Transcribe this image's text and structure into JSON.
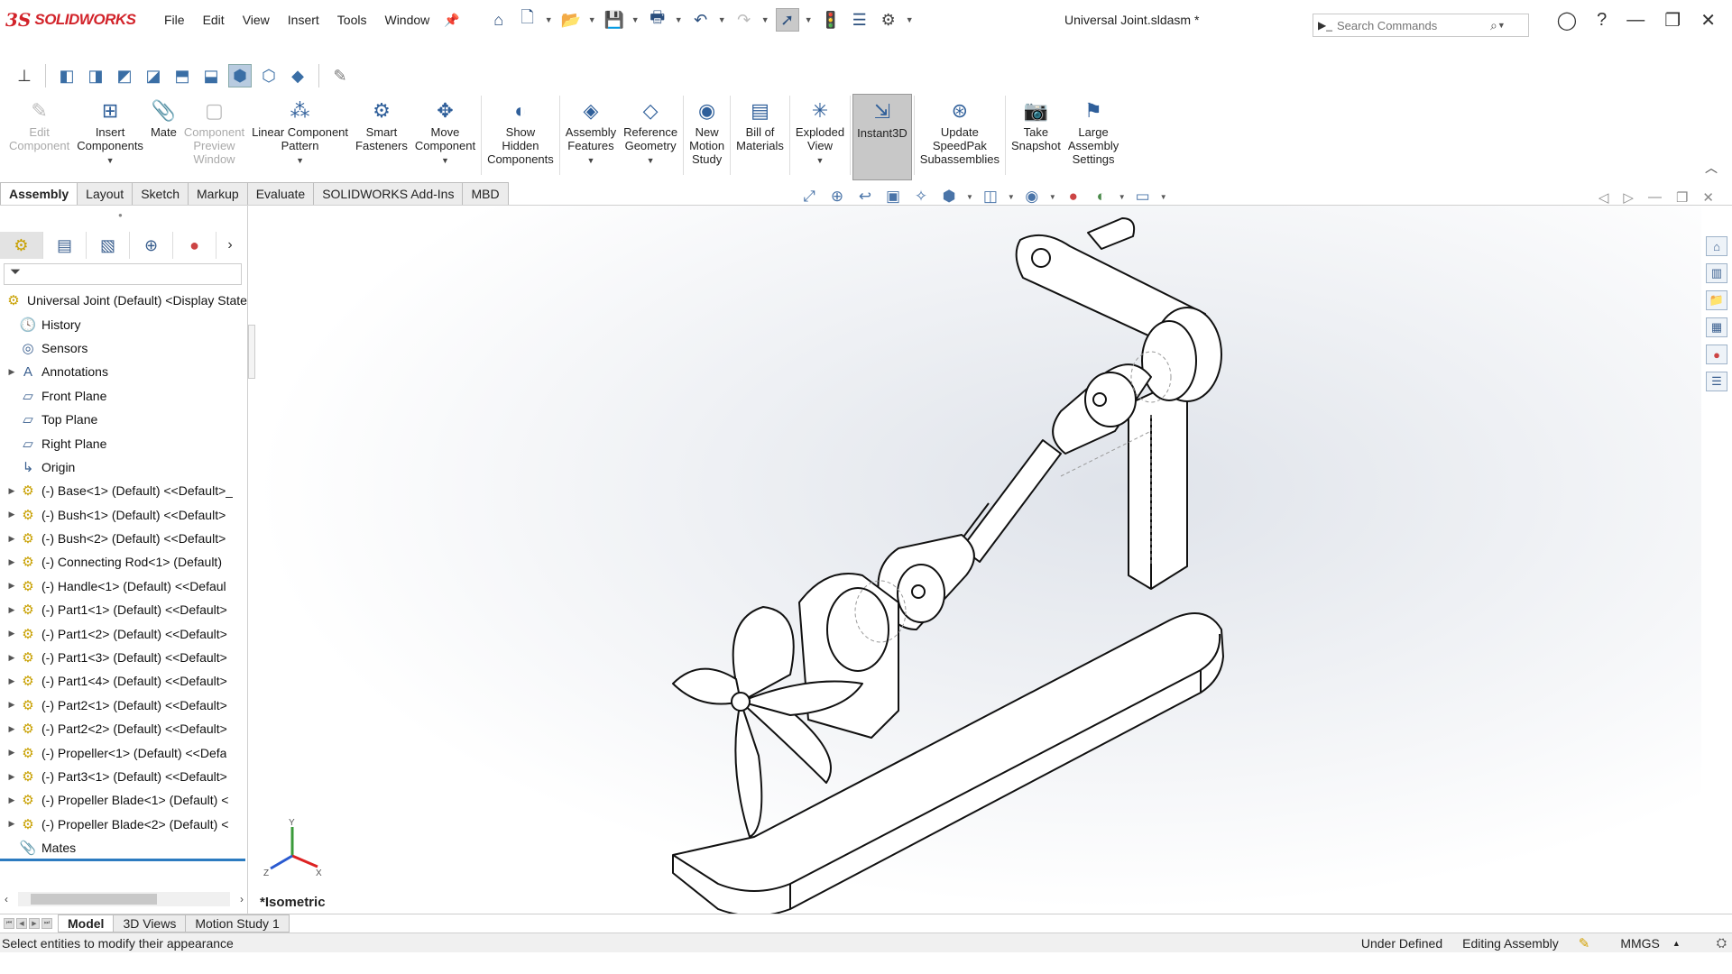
{
  "app": {
    "brand_ds": "3S",
    "brand_name": "SOLIDWORKS"
  },
  "menu": [
    "File",
    "Edit",
    "View",
    "Insert",
    "Tools",
    "Window"
  ],
  "document_title": "Universal Joint.sldasm *",
  "search": {
    "placeholder": "Search Commands"
  },
  "command_manager": [
    {
      "label": "Edit\nComponent",
      "disabled": true,
      "icon": "edit-component-icon"
    },
    {
      "label": "Insert\nComponents",
      "dropdown": true,
      "icon": "insert-components-icon"
    },
    {
      "label": "Mate",
      "icon": "mate-icon"
    },
    {
      "label": "Component\nPreview\nWindow",
      "disabled": true,
      "icon": "component-preview-icon"
    },
    {
      "label": "Linear Component\nPattern",
      "dropdown": true,
      "icon": "linear-pattern-icon"
    },
    {
      "label": "Smart\nFasteners",
      "icon": "smart-fasteners-icon"
    },
    {
      "label": "Move\nComponent",
      "dropdown": true,
      "icon": "move-component-icon"
    },
    {
      "label": "Show\nHidden\nComponents",
      "icon": "show-hidden-icon"
    },
    {
      "label": "Assembly\nFeatures",
      "dropdown": true,
      "icon": "assembly-features-icon"
    },
    {
      "label": "Reference\nGeometry",
      "dropdown": true,
      "icon": "reference-geometry-icon"
    },
    {
      "label": "New\nMotion\nStudy",
      "icon": "motion-study-icon"
    },
    {
      "label": "Bill of\nMaterials",
      "icon": "bom-icon"
    },
    {
      "label": "Exploded\nView",
      "dropdown": true,
      "icon": "exploded-view-icon"
    },
    {
      "label": "Instant3D",
      "active": true,
      "icon": "instant3d-icon"
    },
    {
      "label": "Update\nSpeedPak\nSubassemblies",
      "icon": "speedpak-icon"
    },
    {
      "label": "Take\nSnapshot",
      "icon": "snapshot-icon"
    },
    {
      "label": "Large\nAssembly\nSettings",
      "icon": "large-assembly-icon"
    }
  ],
  "tabs": [
    "Assembly",
    "Layout",
    "Sketch",
    "Markup",
    "Evaluate",
    "SOLIDWORKS Add-Ins",
    "MBD"
  ],
  "active_tab": "Assembly",
  "tree": [
    {
      "label": "Universal Joint (Default) <Display State",
      "icon": "assembly-icon",
      "expand": false,
      "indent": 0
    },
    {
      "label": "History",
      "icon": "history-icon",
      "expand": false,
      "indent": 1
    },
    {
      "label": "Sensors",
      "icon": "sensor-icon",
      "expand": false,
      "indent": 1
    },
    {
      "label": "Annotations",
      "icon": "annotation-icon",
      "expand": true,
      "indent": 1
    },
    {
      "label": "Front Plane",
      "icon": "plane-icon",
      "expand": false,
      "indent": 1
    },
    {
      "label": "Top Plane",
      "icon": "plane-icon",
      "expand": false,
      "indent": 1
    },
    {
      "label": "Right Plane",
      "icon": "plane-icon",
      "expand": false,
      "indent": 1
    },
    {
      "label": "Origin",
      "icon": "origin-icon",
      "expand": false,
      "indent": 1
    },
    {
      "label": "(-) Base<1> (Default) <<Default>_",
      "icon": "part-icon",
      "expand": true,
      "indent": 1
    },
    {
      "label": "(-) Bush<1> (Default) <<Default>",
      "icon": "part-icon",
      "expand": true,
      "indent": 1
    },
    {
      "label": "(-) Bush<2> (Default) <<Default>",
      "icon": "part-icon",
      "expand": true,
      "indent": 1
    },
    {
      "label": "(-) Connecting Rod<1> (Default)",
      "icon": "part-icon",
      "expand": true,
      "indent": 1
    },
    {
      "label": "(-) Handle<1> (Default) <<Defaul",
      "icon": "part-icon",
      "expand": true,
      "indent": 1
    },
    {
      "label": "(-) Part1<1> (Default) <<Default>",
      "icon": "part-icon",
      "expand": true,
      "indent": 1
    },
    {
      "label": "(-) Part1<2> (Default) <<Default>",
      "icon": "part-icon",
      "expand": true,
      "indent": 1
    },
    {
      "label": "(-) Part1<3> (Default) <<Default>",
      "icon": "part-icon",
      "expand": true,
      "indent": 1
    },
    {
      "label": "(-) Part1<4> (Default) <<Default>",
      "icon": "part-icon",
      "expand": true,
      "indent": 1
    },
    {
      "label": "(-) Part2<1> (Default) <<Default>",
      "icon": "part-icon",
      "expand": true,
      "indent": 1
    },
    {
      "label": "(-) Part2<2> (Default) <<Default>",
      "icon": "part-icon",
      "expand": true,
      "indent": 1
    },
    {
      "label": "(-) Propeller<1> (Default) <<Defa",
      "icon": "part-icon",
      "expand": true,
      "indent": 1
    },
    {
      "label": "(-) Part3<1> (Default) <<Default>",
      "icon": "part-icon",
      "expand": true,
      "indent": 1
    },
    {
      "label": "(-) Propeller Blade<1> (Default) <",
      "icon": "part-icon",
      "expand": true,
      "indent": 1
    },
    {
      "label": "(-) Propeller Blade<2> (Default) <",
      "icon": "part-icon",
      "expand": true,
      "indent": 1
    },
    {
      "label": "Mates",
      "icon": "mates-icon",
      "expand": false,
      "indent": 1
    }
  ],
  "view_name": "*Isometric",
  "triad": {
    "x": "X",
    "y": "Y",
    "z": "Z"
  },
  "bottom_tabs": [
    "Model",
    "3D Views",
    "Motion Study 1"
  ],
  "active_bottom_tab": "Model",
  "status": {
    "message": "Select entities to modify their appearance",
    "definition": "Under Defined",
    "mode": "Editing Assembly",
    "units": "MMGS"
  },
  "colors": {
    "brand": "#d2232a",
    "accent": "#2c7bc0",
    "part_icon": "#c8a000"
  }
}
